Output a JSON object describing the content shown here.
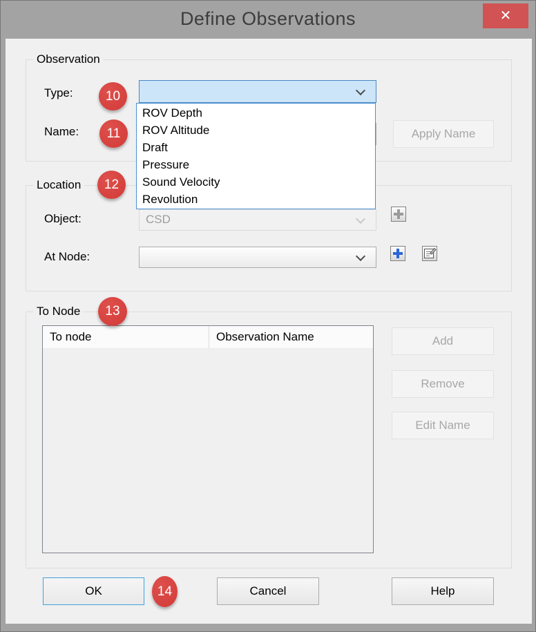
{
  "window": {
    "title": "Define Observations"
  },
  "icons": {
    "close_icon": "✕",
    "chevron_down_icon": "chevron-down",
    "add_object_icon": "gray-plus",
    "add_node_icon": "blue-plus",
    "node_properties_icon": "note-with-pencil"
  },
  "observation": {
    "group_label": "Observation",
    "type_label": "Type:",
    "type_dropdown": {
      "value": "",
      "options": [
        "ROV Depth",
        "ROV Altitude",
        "Draft",
        "Pressure",
        "Sound Velocity",
        "Revolution"
      ]
    },
    "name_label": "Name:",
    "name_value": "",
    "apply_name_button": "Apply Name"
  },
  "location": {
    "group_label": "Location",
    "object_label": "Object:",
    "object_value": "CSD",
    "at_node_label": "At Node:",
    "at_node_value": ""
  },
  "to_node": {
    "group_label": "To Node",
    "table": {
      "columns": [
        "To node",
        "Observation Name"
      ],
      "rows": []
    },
    "add_button": "Add",
    "remove_button": "Remove",
    "edit_name_button": "Edit Name"
  },
  "footer": {
    "ok_button": "OK",
    "cancel_button": "Cancel",
    "help_button": "Help"
  },
  "callouts": {
    "type": "10",
    "name": "11",
    "location": "12",
    "to_node": "13",
    "ok": "14"
  },
  "colors": {
    "titlebar_gray": "#a3a3a3",
    "close_red": "#d15353",
    "dialog_bg": "#f0f0f0",
    "badge_red": "#d8423e",
    "open_combo_fill": "#cde5f8",
    "open_combo_border": "#4788c4",
    "list_border": "#4a90d2",
    "ok_border_blue": "#41a1e0",
    "disabled_text": "#a7a7a7"
  }
}
